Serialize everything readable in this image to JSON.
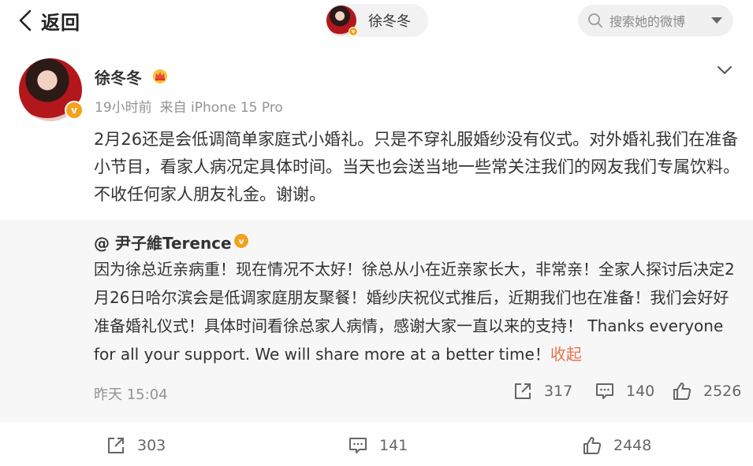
{
  "header": {
    "back_label": "返回",
    "user_chip_name": "徐冬冬",
    "search_placeholder": "搜索她的微博"
  },
  "post": {
    "author_name": "徐冬冬",
    "time": "19小时前",
    "source": "来自 iPhone 15 Pro",
    "text": "2月26还是会低调简单家庭式小婚礼。只是不穿礼服婚纱没有仪式。对外婚礼我们在准备小节目，看家人病况定具体时间。当天也会送当地一些常关注我们的网友我们专属饮料。不收任何家人朋友礼金。谢谢。",
    "repost_count": "303",
    "comment_count": "141",
    "like_count": "2448"
  },
  "repost": {
    "author": "@ 尹子維Terence",
    "text": "因为徐总近亲病重！现在情况不太好！徐总从小在近亲家长大，非常亲！全家人探讨后决定2月26日哈尔滨会是低调家庭朋友聚餐！婚纱庆祝仪式推后，近期我们也在准备！我们会好好准备婚礼仪式！具体时间看徐总家人病情，感谢大家一直以来的支持！ Thanks everyone for all your support.  We will share more at a better time！",
    "collapse_label": "收起",
    "time": "昨天 15:04",
    "repost_count": "317",
    "comment_count": "140",
    "like_count": "2526"
  },
  "colors": {
    "accent_orange": "#eb7350",
    "verified_badge": "#f7a01c"
  }
}
